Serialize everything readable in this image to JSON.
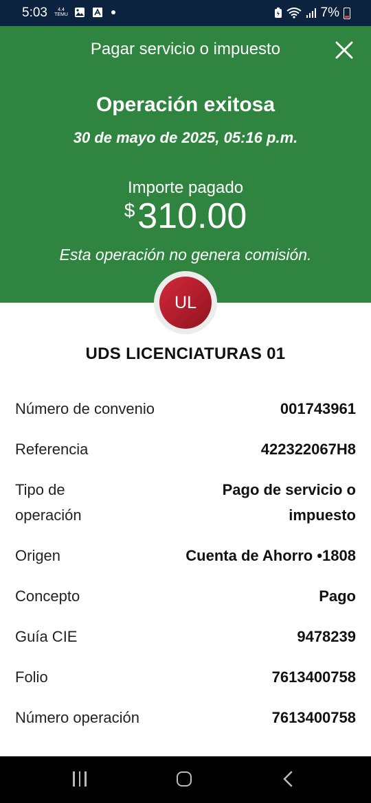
{
  "status_bar": {
    "time": "5:03",
    "temu_label": "4.4\nTEMU",
    "battery_percent": "7%"
  },
  "header": {
    "title": "Pagar servicio o impuesto",
    "close_icon": "close-icon"
  },
  "confirmation": {
    "title": "Operación exitosa",
    "date": "30 de mayo de 2025, 05:16 p.m.",
    "amount_label": "Importe pagado",
    "currency_symbol": "$",
    "amount": "310.00",
    "fee_note": "Esta operación no genera comisión."
  },
  "payee": {
    "initials": "UL",
    "name": "UDS LICENCIATURAS 01"
  },
  "details": [
    {
      "label": "Número de convenio",
      "value": "001743961"
    },
    {
      "label": "Referencia",
      "value": "422322067H8"
    },
    {
      "label": "Tipo de operación",
      "value": "Pago de servicio o impuesto"
    },
    {
      "label": "Origen",
      "value": "Cuenta de Ahorro •1808"
    },
    {
      "label": "Concepto",
      "value": "Pago"
    },
    {
      "label": "Guía CIE",
      "value": "9478239"
    },
    {
      "label": "Folio",
      "value": "7613400758"
    },
    {
      "label": "Número operación",
      "value": "7613400758"
    }
  ],
  "colors": {
    "status_bar": "#0c2340",
    "header_green": "#2f8540",
    "avatar_red": "#c0222f"
  }
}
